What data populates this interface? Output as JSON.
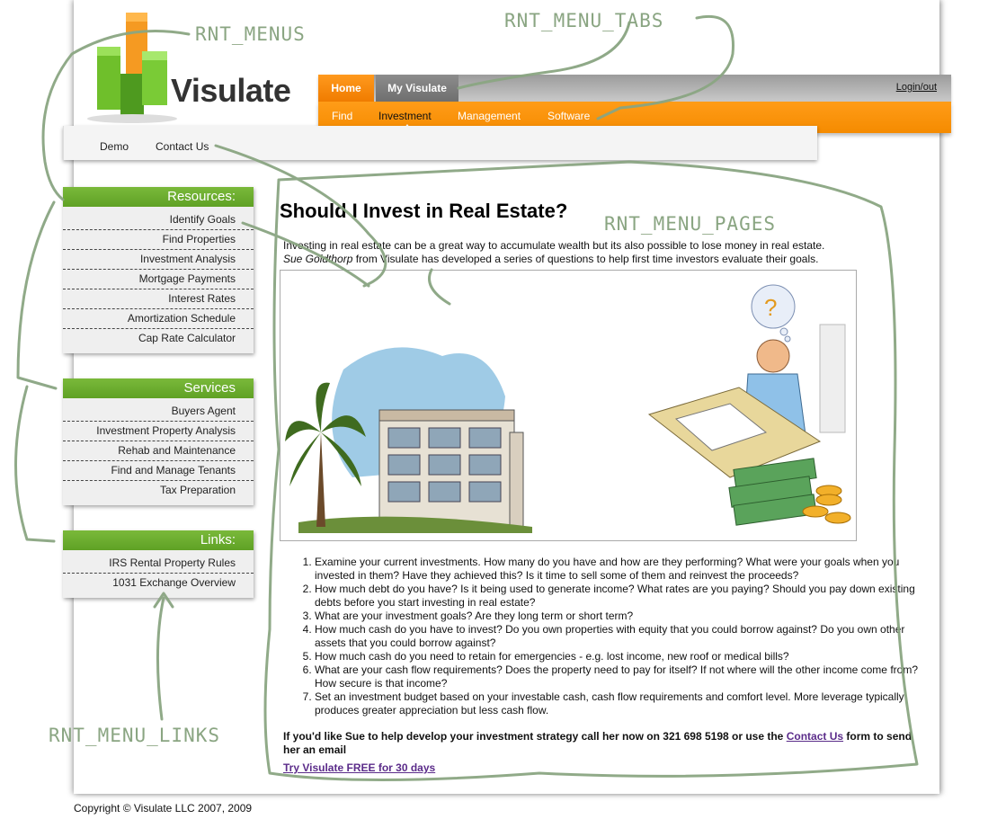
{
  "brand": {
    "name": "Visulate"
  },
  "tabs": [
    {
      "label": "Home"
    },
    {
      "label": "My Visulate"
    }
  ],
  "login_label": "Login/out",
  "subtabs": [
    {
      "label": "Find"
    },
    {
      "label": "Investment"
    },
    {
      "label": "Management"
    },
    {
      "label": "Software"
    }
  ],
  "pages": [
    {
      "label": "Demo"
    },
    {
      "label": "Contact Us"
    }
  ],
  "sidebar": {
    "resources": {
      "title": "Resources:",
      "items": [
        "Identify Goals",
        "Find Properties",
        "Investment Analysis",
        "Mortgage Payments",
        "Interest Rates",
        "Amortization Schedule",
        "Cap Rate Calculator"
      ]
    },
    "services": {
      "title": "Services",
      "items": [
        "Buyers Agent",
        "Investment Property Analysis",
        "Rehab and Maintenance",
        "Find and Manage Tenants",
        "Tax Preparation"
      ]
    },
    "links": {
      "title": "Links:",
      "items": [
        "IRS Rental Property Rules",
        "1031 Exchange Overview"
      ]
    }
  },
  "main": {
    "title": "Should I Invest in Real Estate?",
    "intro_1": "Investing in real estate can be a great way to accumulate wealth but its also possible to lose money in real estate.",
    "intro_name": "Sue Goldthorp",
    "intro_2": " from Visulate has developed a series of questions to help first time investors evaluate their goals.",
    "steps": [
      "Examine your current investments. How many do you have and how are they performing? What were your goals when you invested in them? Have they achieved this? Is it time to sell some of them and reinvest the proceeds?",
      "How much debt do you have? Is it being used to generate income? What rates are you paying? Should you pay down existing debts before you start investing in real estate?",
      "What are your investment goals? Are they long term or short term?",
      "How much cash do you have to invest? Do you own properties with equity that you could borrow against? Do you own other assets that you could borrow against?",
      "How much cash do you need to retain for emergencies - e.g. lost income, new roof or medical bills?",
      "What are your cash flow requirements? Does the property need to pay for itself? If not where will the other income come from? How secure is that income?",
      "Set an investment budget based on your investable cash, cash flow requirements and comfort level. More leverage typically produces greater appreciation but less cash flow."
    ],
    "cta_before": "If you'd like Sue to help develop your investment strategy call her now on 321 698 5198 or use the ",
    "cta_link": "Contact Us",
    "cta_after": " form to send her an email",
    "trial_link": "Try Visulate FREE for 30 days"
  },
  "copyright": "Copyright © Visulate LLC 2007, 2009",
  "annotations": {
    "menus": "RNT_MENUS",
    "menu_tabs": "RNT_MENU_TABS",
    "menu_pages": "RNT_MENU_PAGES",
    "menu_links": "RNT_MENU_LINKS"
  },
  "colors": {
    "orange": "#f58b00",
    "green": "#6aab2e",
    "annotation": "#8aa582",
    "gray_tab": "#7a7a7a"
  }
}
